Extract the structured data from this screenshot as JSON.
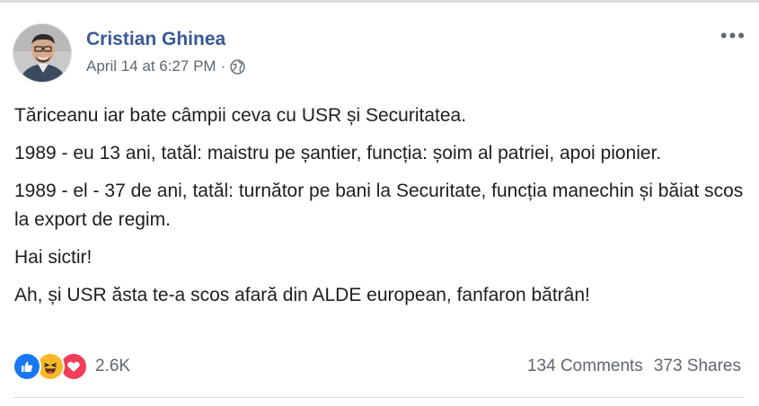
{
  "post": {
    "author": "Cristian Ghinea",
    "timestamp": "April 14 at 6:27 PM",
    "separator": "·",
    "audience_icon": "globe-icon",
    "more_label": "•••",
    "paragraphs": [
      "Tăriceanu iar bate câmpii ceva cu USR și Securitatea.",
      "1989 - eu 13 ani, tatăl: maistru pe șantier, funcția: șoim al patriei, apoi pionier.",
      "1989 - el - 37 de ani, tatăl: turnător pe bani la Securitate, funcția manechin și băiat scos la export de regim.",
      "Hai sictir!",
      "Ah, și USR ăsta te-a scos afară din ALDE european, fanfaron bătrân!"
    ]
  },
  "footer": {
    "reaction_icons": [
      "like-icon",
      "haha-icon",
      "love-icon"
    ],
    "reaction_count": "2.6K",
    "comments": "134 Comments",
    "shares": "373 Shares"
  },
  "colors": {
    "author_link": "#385898",
    "meta_text": "#606770",
    "like": "#1877f2",
    "haha": "#f7b928",
    "love": "#f33e58"
  }
}
